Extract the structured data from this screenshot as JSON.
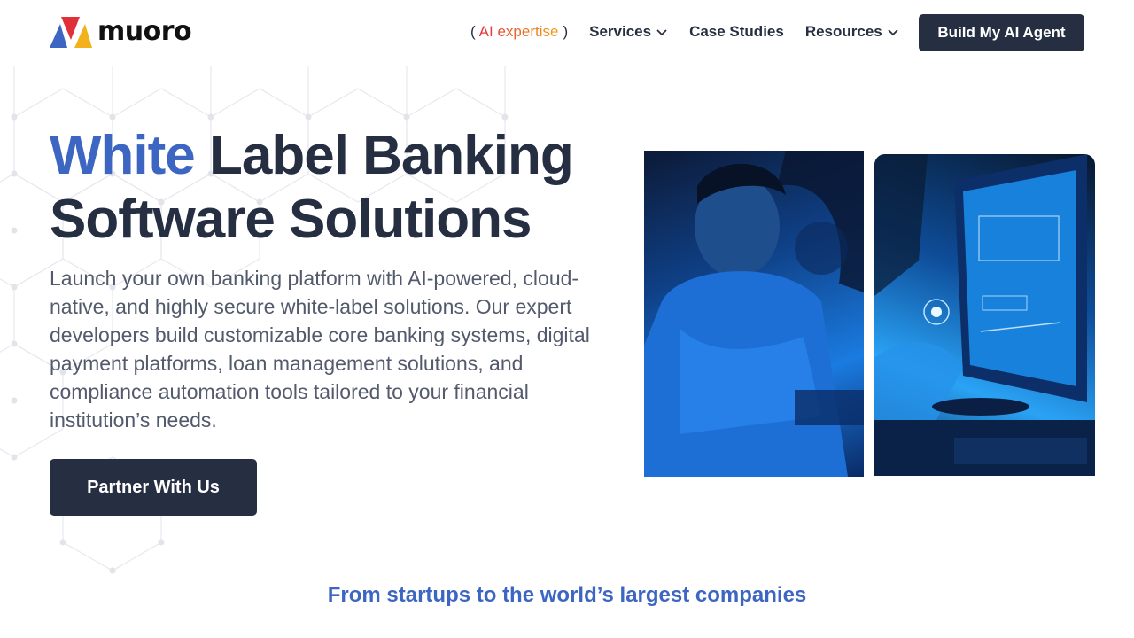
{
  "brand": {
    "name": "muoro"
  },
  "nav": {
    "ai_expertise": {
      "open": "(",
      "label": "AI expertise",
      "close": ")"
    },
    "items": [
      {
        "label": "Services",
        "has_dropdown": true
      },
      {
        "label": "Case Studies",
        "has_dropdown": false
      },
      {
        "label": "Resources",
        "has_dropdown": true
      }
    ],
    "cta_label": "Build My AI Agent"
  },
  "hero": {
    "title_accent": "White",
    "title_rest": "Label Banking Software Solutions",
    "description": "Launch your own banking platform with AI-powered, cloud-native, and highly secure white-label solutions. Our expert developers build customizable core banking systems, digital payment platforms, loan management solutions, and compliance automation tools tailored to your financial institution’s needs.",
    "cta_label": "Partner With Us"
  },
  "trust_heading": "From startups to the world’s largest companies",
  "colors": {
    "accent": "#3d66c2",
    "dark": "#262f42",
    "logo_red": "#e0303a",
    "logo_blue": "#3d66c2",
    "logo_yellow": "#f2b21b"
  },
  "icons": [
    "chevron-down-icon",
    "logo-mark-icon"
  ]
}
